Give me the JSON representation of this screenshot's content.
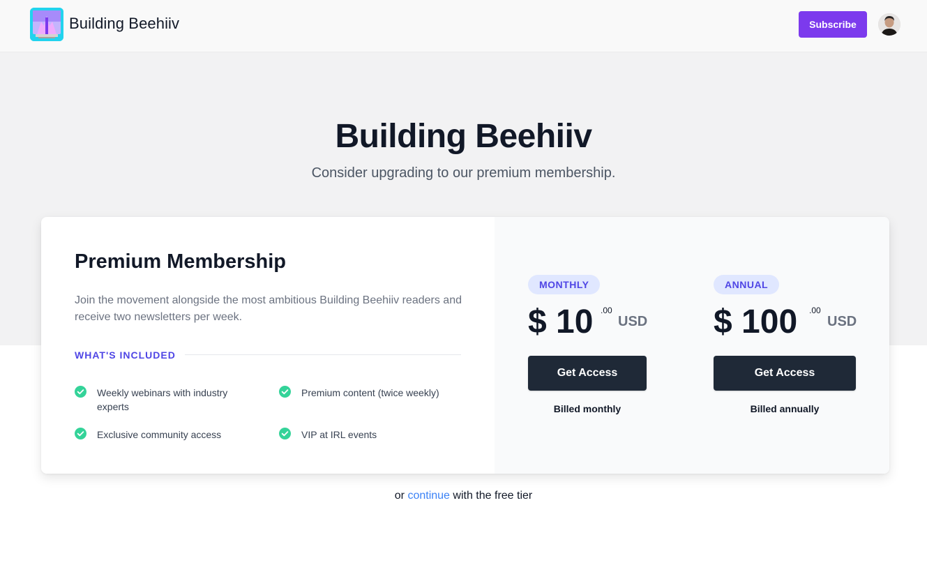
{
  "header": {
    "brand": "Building Beehiiv",
    "subscribe_label": "Subscribe",
    "accent_color": "#7c3aed"
  },
  "hero": {
    "title": "Building Beehiiv",
    "subtitle": "Consider upgrading to our premium membership."
  },
  "membership": {
    "title": "Premium Membership",
    "description": "Join the movement alongside the most ambitious Building Beehiiv readers and receive two newsletters per week.",
    "included_label": "WHAT'S INCLUDED",
    "features": [
      "Weekly webinars with industry experts",
      "Premium content (twice weekly)",
      "Exclusive community access",
      "VIP at IRL events"
    ]
  },
  "plans": [
    {
      "badge": "MONTHLY",
      "currency_symbol": "$",
      "amount": "10",
      "cents": ".00",
      "currency": "USD",
      "button": "Get Access",
      "billing": "Billed monthly"
    },
    {
      "badge": "ANNUAL",
      "currency_symbol": "$",
      "amount": "100",
      "cents": ".00",
      "currency": "USD",
      "button": "Get Access",
      "billing": "Billed annually"
    }
  ],
  "footer": {
    "prefix": "or",
    "link": "continue",
    "suffix": "with the free tier"
  },
  "icons": {
    "logo": "building-logo-icon",
    "avatar": "user-avatar",
    "check": "check-circle-icon"
  }
}
